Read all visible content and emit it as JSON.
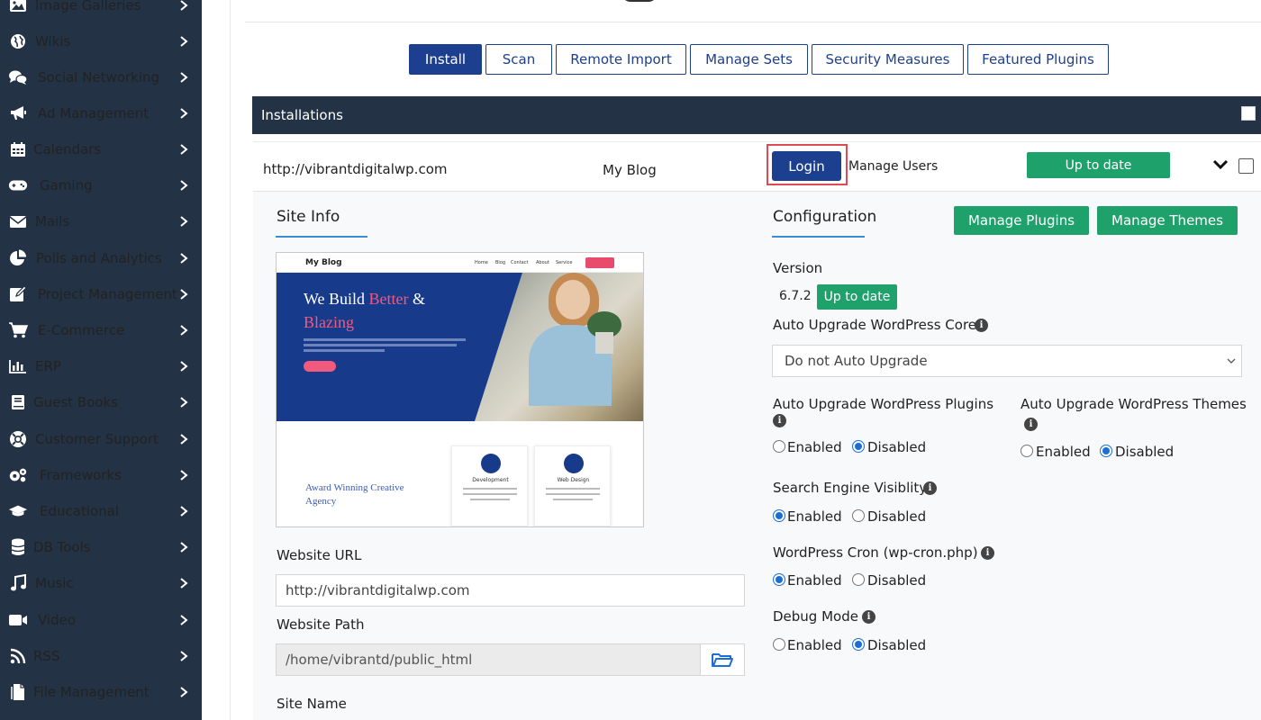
{
  "sidebar": {
    "items": [
      {
        "label": "Image Galleries",
        "icon": "image-icon"
      },
      {
        "label": "Wikis",
        "icon": "globe-icon"
      },
      {
        "label": "Social Networking",
        "icon": "chat-icon"
      },
      {
        "label": "Ad Management",
        "icon": "megaphone-icon"
      },
      {
        "label": "Calendars",
        "icon": "calendar-icon"
      },
      {
        "label": "Gaming",
        "icon": "gamepad-icon"
      },
      {
        "label": "Mails",
        "icon": "mail-icon"
      },
      {
        "label": "Polls and Analytics",
        "icon": "pie-chart-icon"
      },
      {
        "label": "Project Management",
        "icon": "edit-icon"
      },
      {
        "label": "E-Commerce",
        "icon": "cart-icon"
      },
      {
        "label": "ERP",
        "icon": "bar-chart-icon"
      },
      {
        "label": "Guest Books",
        "icon": "book-icon"
      },
      {
        "label": "Customer Support",
        "icon": "lifebuoy-icon"
      },
      {
        "label": "Frameworks",
        "icon": "cogs-icon"
      },
      {
        "label": "Educational",
        "icon": "graduation-cap-icon"
      },
      {
        "label": "DB Tools",
        "icon": "database-icon"
      },
      {
        "label": "Music",
        "icon": "music-icon"
      },
      {
        "label": "Video",
        "icon": "video-icon"
      },
      {
        "label": "RSS",
        "icon": "rss-icon"
      },
      {
        "label": "File Management",
        "icon": "file-icon"
      }
    ]
  },
  "tabs": [
    "Install",
    "Scan",
    "Remote Import",
    "Manage Sets",
    "Security Measures",
    "Featured Plugins"
  ],
  "installations": {
    "header": "Installations",
    "row": {
      "url": "http://vibrantdigitalwp.com",
      "name": "My Blog",
      "login_label": "Login",
      "manage_users_label": "Manage Users",
      "status_label": "Up to date"
    }
  },
  "site_info": {
    "title": "Site Info",
    "website_url_label": "Website URL",
    "website_url_value": "http://vibrantdigitalwp.com",
    "website_path_label": "Website Path",
    "website_path_value": "/home/vibrantd/public_html",
    "site_name_label": "Site Name"
  },
  "preview": {
    "logo": "My Blog",
    "menu": [
      "Home",
      "Blog",
      "Contact",
      "About",
      "Service"
    ],
    "hero_line1": "We Build ",
    "hero_pink1": "Better",
    "hero_amp": " &",
    "hero_pink2": "Blazing",
    "award_line1": "Award Winning Creative",
    "award_line2": "Agency",
    "card1": "Development",
    "card2": "Web Design"
  },
  "config": {
    "title": "Configuration",
    "manage_plugins_label": "Manage Plugins",
    "manage_themes_label": "Manage Themes",
    "version_label": "Version",
    "version_value": "6.7.2",
    "version_status": "Up to date",
    "auto_core_label": "Auto Upgrade WordPress Core",
    "auto_core_value": "Do not Auto Upgrade",
    "auto_plugins_label": "Auto Upgrade WordPress Plugins",
    "auto_themes_label": "Auto Upgrade WordPress Themes",
    "search_engine_label": "Search Engine Visiblity",
    "cron_label": "WordPress Cron (wp-cron.php)",
    "debug_label": "Debug Mode",
    "enabled_label": "Enabled",
    "disabled_label": "Disabled"
  }
}
